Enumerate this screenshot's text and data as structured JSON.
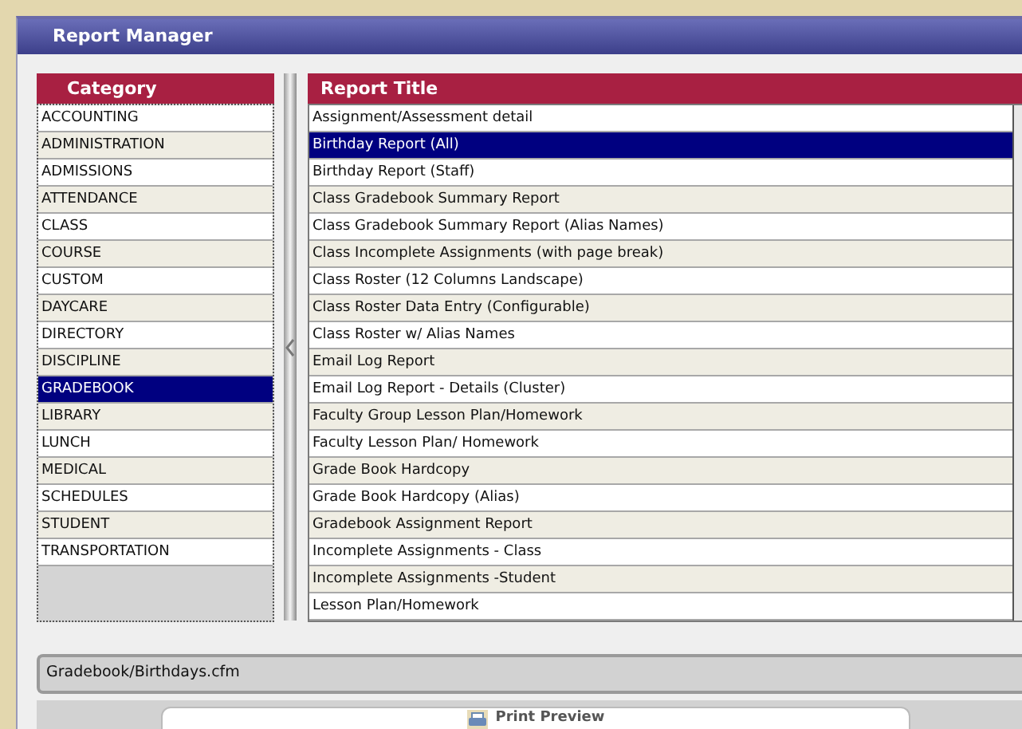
{
  "window": {
    "title": "Report Manager"
  },
  "category": {
    "heading": "Category",
    "items": [
      {
        "label": "ACCOUNTING",
        "selected": false
      },
      {
        "label": "ADMINISTRATION",
        "selected": false
      },
      {
        "label": "ADMISSIONS",
        "selected": false
      },
      {
        "label": "ATTENDANCE",
        "selected": false
      },
      {
        "label": "CLASS",
        "selected": false
      },
      {
        "label": "COURSE",
        "selected": false
      },
      {
        "label": "CUSTOM",
        "selected": false
      },
      {
        "label": "DAYCARE",
        "selected": false
      },
      {
        "label": "DIRECTORY",
        "selected": false
      },
      {
        "label": "DISCIPLINE",
        "selected": false
      },
      {
        "label": "GRADEBOOK",
        "selected": true
      },
      {
        "label": "LIBRARY",
        "selected": false
      },
      {
        "label": "LUNCH",
        "selected": false
      },
      {
        "label": "MEDICAL",
        "selected": false
      },
      {
        "label": "SCHEDULES",
        "selected": false
      },
      {
        "label": "STUDENT",
        "selected": false
      },
      {
        "label": "TRANSPORTATION",
        "selected": false
      }
    ]
  },
  "reports": {
    "heading": "Report Title",
    "items": [
      {
        "label": "Assignment/Assessment detail",
        "selected": false
      },
      {
        "label": "Birthday Report (All)",
        "selected": true
      },
      {
        "label": "Birthday Report (Staff)",
        "selected": false
      },
      {
        "label": "Class Gradebook Summary Report",
        "selected": false
      },
      {
        "label": "Class Gradebook Summary Report (Alias Names)",
        "selected": false
      },
      {
        "label": "Class Incomplete Assignments (with page break)",
        "selected": false
      },
      {
        "label": "Class Roster (12 Columns Landscape)",
        "selected": false
      },
      {
        "label": "Class Roster Data Entry (Configurable)",
        "selected": false
      },
      {
        "label": "Class Roster w/ Alias Names",
        "selected": false
      },
      {
        "label": "Email Log Report",
        "selected": false
      },
      {
        "label": "Email Log Report - Details (Cluster)",
        "selected": false
      },
      {
        "label": "Faculty Group Lesson Plan/Homework",
        "selected": false
      },
      {
        "label": "Faculty Lesson Plan/ Homework",
        "selected": false
      },
      {
        "label": "Grade Book Hardcopy",
        "selected": false
      },
      {
        "label": "Grade Book Hardcopy (Alias)",
        "selected": false
      },
      {
        "label": "Gradebook Assignment Report",
        "selected": false
      },
      {
        "label": "Incomplete Assignments - Class",
        "selected": false
      },
      {
        "label": "Incomplete Assignments -Student",
        "selected": false
      },
      {
        "label": "Lesson Plan/Homework",
        "selected": false
      }
    ]
  },
  "path_field": {
    "value": "Gradebook/Birthdays.cfm"
  },
  "buttons": [
    {
      "label": "Print Preview"
    }
  ]
}
